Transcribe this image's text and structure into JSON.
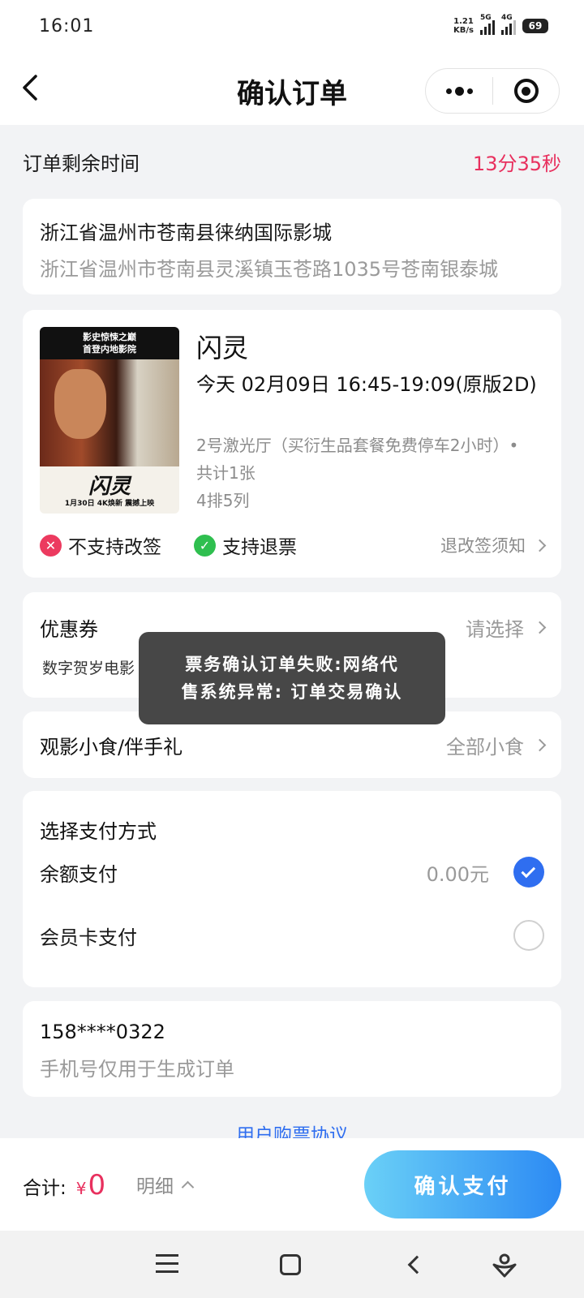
{
  "status_bar": {
    "time": "16:01",
    "net_speed_value": "1.21",
    "net_speed_unit": "KB/s",
    "sim1": "5G",
    "sim2": "4G",
    "battery": "69"
  },
  "nav": {
    "title": "确认订单"
  },
  "timer": {
    "label": "订单剩余时间",
    "value": "13分35秒"
  },
  "cinema": {
    "name": "浙江省温州市苍南县徕纳国际影城",
    "address": "浙江省温州市苍南县灵溪镇玉苍路1035号苍南银泰城"
  },
  "movie": {
    "title": "闪灵",
    "showtime": "今天 02月09日 16:45-19:09(原版2D)",
    "hall": "2号激光厅（买衍生品套餐免费停车2小时）•",
    "count": "共计1张",
    "seat": "4排5列",
    "poster": {
      "top_line1": "影史惊悚之巅",
      "top_line2": "首登内地影院",
      "name": "闪灵",
      "date": "1月30日 4K焕新 震撼上映"
    },
    "policy_no_change": "不支持改签",
    "policy_refund": "支持退票",
    "policy_notice": "退改签须知"
  },
  "coupon": {
    "label": "优惠券",
    "action": "请选择",
    "sub": "数字贺岁电影"
  },
  "snack": {
    "label": "观影小食/伴手礼",
    "action": "全部小食"
  },
  "payment": {
    "heading": "选择支付方式",
    "balance_label": "余额支付",
    "balance_amount": "0.00元",
    "member_label": "会员卡支付",
    "selected": "balance"
  },
  "phone": {
    "number": "158****0322",
    "hint": "手机号仅用于生成订单"
  },
  "agreement": "用户购票协议",
  "bottom": {
    "total_label": "合计:",
    "currency": "¥",
    "total": "0",
    "detail": "明细",
    "pay_button": "确认支付"
  },
  "toast": {
    "line1": "票务确认订单失败:网络代",
    "line2": "售系统异常: 订单交易确认"
  },
  "colors": {
    "accent_blue": "#2f6ef0",
    "price_red": "#e8305e",
    "refund_green": "#2fbf4f"
  }
}
